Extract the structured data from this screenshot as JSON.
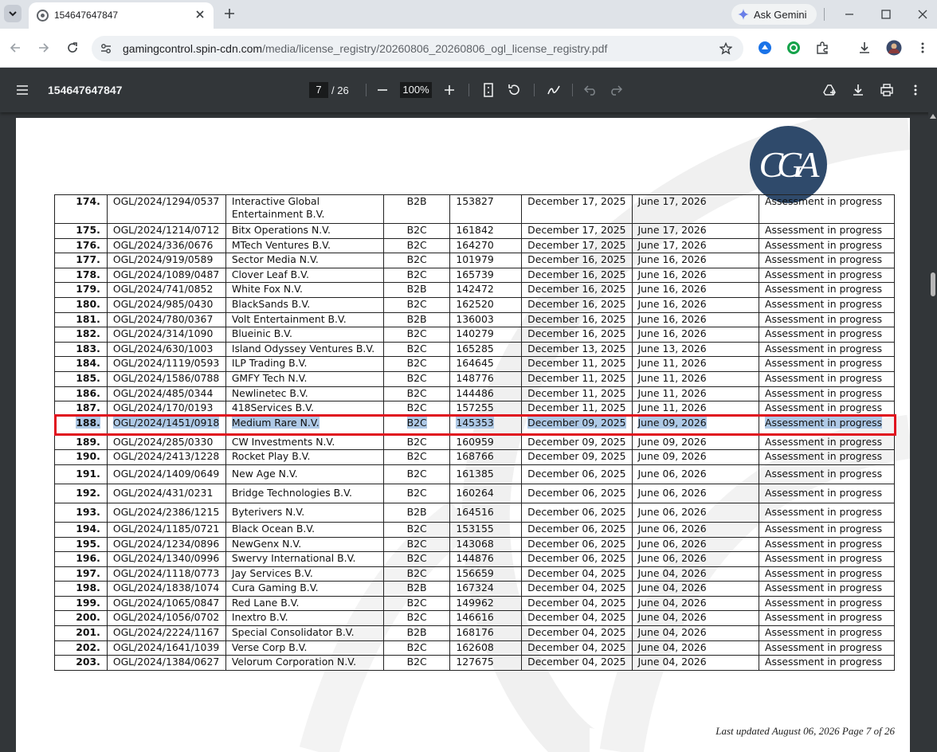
{
  "browser": {
    "tab_title": "154647647847",
    "ask_gemini_label": "Ask Gemini",
    "url_host": "gamingcontrol.spin-cdn.com",
    "url_path": "/media/license_registry/20260806_20260806_ogl_license_registry.pdf"
  },
  "pdf": {
    "title": "154647647847",
    "current_page": "7",
    "total_pages": "/ 26",
    "zoom": "100%"
  },
  "registry": {
    "rows": [
      {
        "num": "174.",
        "license": "OGL/2024/1294/0537",
        "company": "Interactive Global",
        "company_line2": "Entertainment B.V.",
        "type": "B2B",
        "id": "153827",
        "issued": "December 17, 2025",
        "expires": "June 17, 2026",
        "status": "Assessment in progress"
      },
      {
        "num": "175.",
        "license": "OGL/2024/1214/0712",
        "company": "Bitx Operations N.V.",
        "type": "B2C",
        "id": "161842",
        "issued": "December 17, 2025",
        "expires": "June 17, 2026",
        "status": "Assessment in progress"
      },
      {
        "num": "176.",
        "license": "OGL/2024/336/0676",
        "company": "MTech Ventures B.V.",
        "type": "B2C",
        "id": "164270",
        "issued": "December 17, 2025",
        "expires": "June 17, 2026",
        "status": "Assessment in progress"
      },
      {
        "num": "177.",
        "license": "OGL/2024/919/0589",
        "company": "Sector Media N.V.",
        "type": "B2C",
        "id": "101979",
        "issued": "December 16, 2025",
        "expires": "June 16, 2026",
        "status": "Assessment in progress"
      },
      {
        "num": "178.",
        "license": "OGL/2024/1089/0487",
        "company": "Clover Leaf B.V.",
        "type": "B2C",
        "id": "165739",
        "issued": "December 16, 2025",
        "expires": "June 16, 2026",
        "status": "Assessment in progress"
      },
      {
        "num": "179.",
        "license": "OGL/2024/741/0852",
        "company": "White Fox N.V.",
        "type": "B2B",
        "id": "142472",
        "issued": "December 16, 2025",
        "expires": "June 16, 2026",
        "status": "Assessment in progress"
      },
      {
        "num": "180.",
        "license": "OGL/2024/985/0430",
        "company": "BlackSands B.V.",
        "type": "B2C",
        "id": "162520",
        "issued": "December 16, 2025",
        "expires": "June 16, 2026",
        "status": "Assessment in progress"
      },
      {
        "num": "181.",
        "license": "OGL/2024/780/0367",
        "company": "Volt Entertainment B.V.",
        "type": "B2B",
        "id": "136003",
        "issued": "December 16, 2025",
        "expires": "June 16, 2026",
        "status": "Assessment in progress"
      },
      {
        "num": "182.",
        "license": "OGL/2024/314/1090",
        "company": "Blueinic B.V.",
        "type": "B2C",
        "id": "140279",
        "issued": "December 16, 2025",
        "expires": "June 16, 2026",
        "status": "Assessment in progress"
      },
      {
        "num": "183.",
        "license": "OGL/2024/630/1003",
        "company": "Island Odyssey Ventures B.V.",
        "type": "B2C",
        "id": "165285",
        "issued": "December 13, 2025",
        "expires": "June 13, 2026",
        "status": "Assessment in progress"
      },
      {
        "num": "184.",
        "license": "OGL/2024/1119/0593",
        "company": "ILP Trading B.V.",
        "type": "B2C",
        "id": "164645",
        "issued": "December 11, 2025",
        "expires": "June 11, 2026",
        "status": "Assessment in progress"
      },
      {
        "num": "185.",
        "license": "OGL/2024/1586/0788",
        "company": "GMFY Tech N.V.",
        "type": "B2C",
        "id": "148776",
        "issued": "December 11, 2025",
        "expires": "June 11, 2026",
        "status": "Assessment in progress"
      },
      {
        "num": "186.",
        "license": "OGL/2024/485/0344",
        "company": "Newlinetec B.V.",
        "type": "B2C",
        "id": "144486",
        "issued": "December 11, 2025",
        "expires": "June 11, 2026",
        "status": "Assessment in progress"
      },
      {
        "num": "187.",
        "license": "OGL/2024/170/0193",
        "company": "418Services B.V.",
        "type": "B2C",
        "id": "157255",
        "issued": "December 11, 2025",
        "expires": "June 11, 2026",
        "status": "Assessment in progress"
      },
      {
        "num": "188.",
        "license": "OGL/2024/1451/0918",
        "company": "Medium Rare N.V.",
        "type": "B2C",
        "id": "145353",
        "issued": "December 09, 2025",
        "expires": "June 09, 2026",
        "status": "Assessment in progress"
      },
      {
        "num": "189.",
        "license": "OGL/2024/285/0330",
        "company": "CW Investments N.V.",
        "type": "B2C",
        "id": "160959",
        "issued": "December 09, 2025",
        "expires": "June 09, 2026",
        "status": "Assessment in progress"
      },
      {
        "num": "190.",
        "license": "OGL/2024/2413/1228",
        "company": "Rocket Play B.V.",
        "type": "B2C",
        "id": "168766",
        "issued": "December 09, 2025",
        "expires": "June 09, 2026",
        "status": "Assessment in progress"
      },
      {
        "num": "191.",
        "license": "OGL/2024/1409/0649",
        "company": "New Age N.V.",
        "type": "B2C",
        "id": "161385",
        "issued": "December 06, 2025",
        "expires": "June 06, 2026",
        "status": "Assessment in progress"
      },
      {
        "num": "192.",
        "license": "OGL/2024/431/0231",
        "company": "Bridge Technologies B.V.",
        "type": "B2C",
        "id": "160264",
        "issued": "December 06, 2025",
        "expires": "June 06, 2026",
        "status": "Assessment in progress"
      },
      {
        "num": "193.",
        "license": "OGL/2024/2386/1215",
        "company": "Byterivers N.V.",
        "type": "B2B",
        "id": "164516",
        "issued": "December 06, 2025",
        "expires": "June 06, 2026",
        "status": "Assessment in progress"
      },
      {
        "num": "194.",
        "license": "OGL/2024/1185/0721",
        "company": "Black Ocean B.V.",
        "type": "B2C",
        "id": "153155",
        "issued": "December 06, 2025",
        "expires": "June 06, 2026",
        "status": "Assessment in progress"
      },
      {
        "num": "195.",
        "license": "OGL/2024/1234/0896",
        "company": "NewGenx N.V.",
        "type": "B2C",
        "id": "143068",
        "issued": "December 06, 2025",
        "expires": "June 06, 2026",
        "status": "Assessment in progress"
      },
      {
        "num": "196.",
        "license": "OGL/2024/1340/0996",
        "company": "Swervy International B.V.",
        "type": "B2C",
        "id": "144876",
        "issued": "December 06, 2025",
        "expires": "June 06, 2026",
        "status": "Assessment in progress"
      },
      {
        "num": "197.",
        "license": "OGL/2024/1118/0773",
        "company": "Jay Services B.V.",
        "type": "B2C",
        "id": "156659",
        "issued": "December 04, 2025",
        "expires": "June 04, 2026",
        "status": "Assessment in progress"
      },
      {
        "num": "198.",
        "license": "OGL/2024/1838/1074",
        "company": "Cura Gaming B.V.",
        "type": "B2B",
        "id": "167324",
        "issued": "December 04, 2025",
        "expires": "June 04, 2026",
        "status": "Assessment in progress"
      },
      {
        "num": "199.",
        "license": "OGL/2024/1065/0847",
        "company": "Red Lane B.V.",
        "type": "B2C",
        "id": "149962",
        "issued": "December 04, 2025",
        "expires": "June 04, 2026",
        "status": "Assessment in progress"
      },
      {
        "num": "200.",
        "license": "OGL/2024/1056/0702",
        "company": "Inextro B.V.",
        "type": "B2C",
        "id": "146616",
        "issued": "December 04, 2025",
        "expires": "June 04, 2026",
        "status": "Assessment in progress"
      },
      {
        "num": "201.",
        "license": "OGL/2024/2224/1167",
        "company": "Special Consolidator B.V.",
        "type": "B2B",
        "id": "168176",
        "issued": "December 04, 2025",
        "expires": "June 04, 2026",
        "status": "Assessment in progress"
      },
      {
        "num": "202.",
        "license": "OGL/2024/1641/1039",
        "company": "Verse Corp B.V.",
        "type": "B2C",
        "id": "162608",
        "issued": "December 04, 2025",
        "expires": "June 04, 2026",
        "status": "Assessment in progress"
      },
      {
        "num": "203.",
        "license": "OGL/2024/1384/0627",
        "company": "Velorum Corporation N.V.",
        "type": "B2C",
        "id": "127675",
        "issued": "December 04, 2025",
        "expires": "June 04, 2026",
        "status": "Assessment in progress"
      }
    ],
    "selected_row": "188.",
    "footer": "Last updated August 06, 2026  Page 7 of 26"
  },
  "colors": {
    "highlight_border": "#e0101e",
    "selection": "#aec9e6",
    "seal": "#2f4a6b"
  },
  "icons": [
    "tab-search-icon",
    "favicon-icon",
    "close-icon",
    "plus-icon",
    "gemini-spark-icon",
    "minimize-icon",
    "maximize-icon",
    "window-close-icon",
    "back-arrow-icon",
    "forward-arrow-icon",
    "reload-icon",
    "site-settings-icon",
    "star-icon",
    "extension-icon",
    "download-icon",
    "profile-avatar-icon",
    "more-vert-icon",
    "menu-icon",
    "zoom-out-icon",
    "zoom-in-icon",
    "fit-page-icon",
    "rotate-icon",
    "annotate-icon",
    "undo-icon",
    "redo-icon",
    "save-to-drive-icon",
    "print-icon"
  ]
}
